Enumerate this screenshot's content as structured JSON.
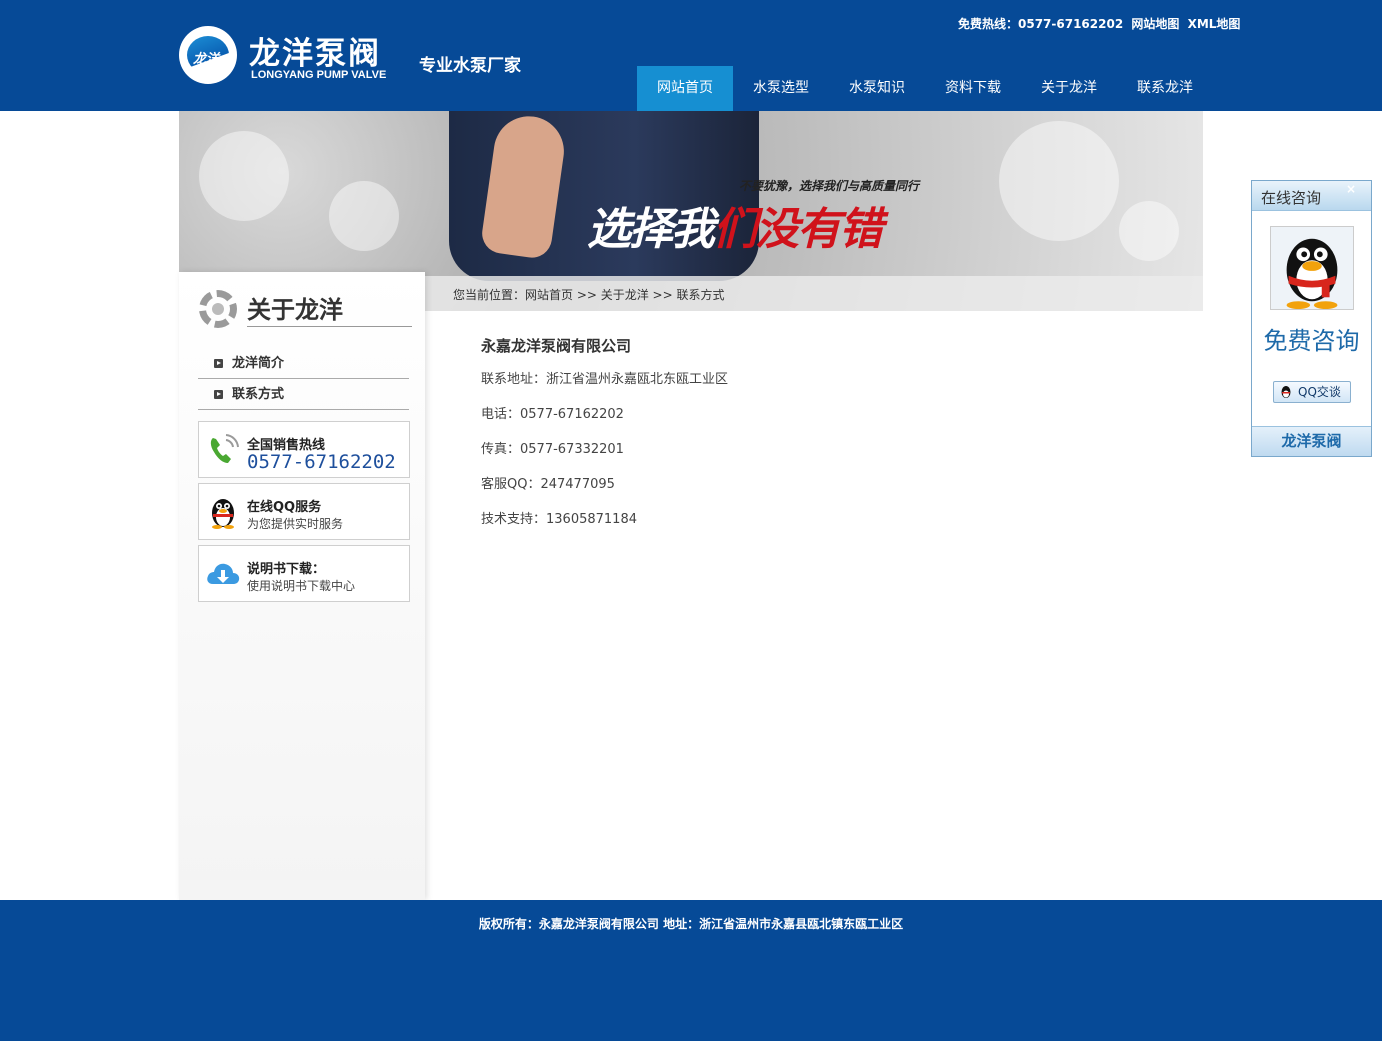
{
  "header": {
    "logo_cn": "龙洋泵阀",
    "logo_en": "LONGYANG PUMP VALVE",
    "logo_mark": "龙洋",
    "slogan": "专业水泵厂家",
    "hotline": "免费热线：0577-67162202",
    "sitemap": "网站地图",
    "xml_sitemap": "XML地图"
  },
  "nav": {
    "items": [
      {
        "label": "网站首页"
      },
      {
        "label": "水泵选型"
      },
      {
        "label": "水泵知识"
      },
      {
        "label": "资料下载"
      },
      {
        "label": "关于龙洋"
      },
      {
        "label": "联系龙洋"
      }
    ],
    "active_index": 0
  },
  "banner": {
    "tagline_small": "不要犹豫，选择我们与高质量同行",
    "tagline_big_white": "选择我",
    "tagline_big_red": "们没有错"
  },
  "breadcrumb": {
    "text": "您当前位置：网站首页 >> 关于龙洋 >> 联系方式"
  },
  "sidebar": {
    "title": "关于龙洋",
    "menu": [
      {
        "label": "龙洋简介"
      },
      {
        "label": "联系方式"
      }
    ],
    "boxes": {
      "hotline_title": "全国销售热线",
      "hotline_number": "0577-67162202",
      "qq_title": "在线QQ服务",
      "qq_sub": "为您提供实时服务",
      "download_title": "说明书下载：",
      "download_sub": "使用说明书下载中心"
    }
  },
  "content": {
    "company": "永嘉龙洋泵阀有限公司",
    "lines": [
      "联系地址：浙江省温州永嘉瓯北东瓯工业区",
      "电话：0577-67162202",
      "传真：0577-67332201",
      "客服QQ：247477095",
      "技术支持：13605871184"
    ]
  },
  "qq_panel": {
    "title": "在线咨询",
    "close": "×",
    "free": "免费咨询",
    "button": "QQ交谈",
    "footer": "龙洋泵阀"
  },
  "footer": {
    "text": "版权所有：永嘉龙洋泵阀有限公司 地址：浙江省温州市永嘉县瓯北镇东瓯工业区"
  },
  "colors": {
    "brand_blue": "#064a97",
    "nav_active": "#168fd2",
    "accent_red": "#d0121b"
  }
}
